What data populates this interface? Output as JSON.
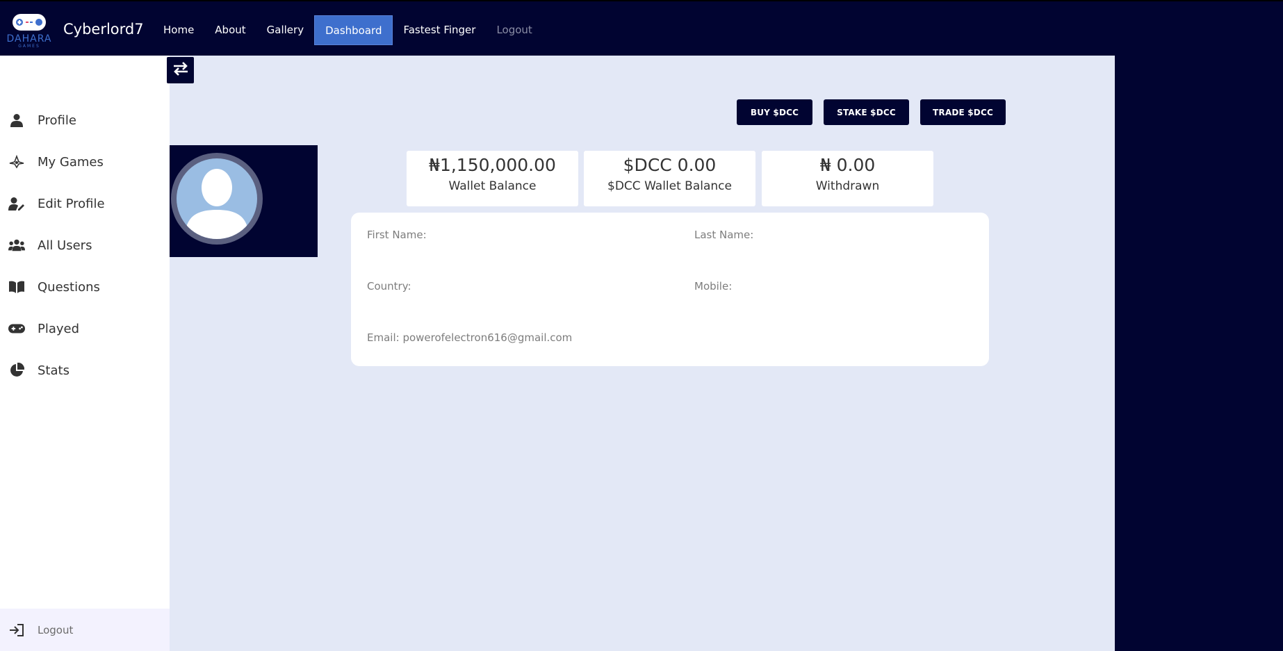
{
  "brand": {
    "name": "Cyberlord7",
    "logo_text": "DAHARA",
    "logo_sub": "GAMES"
  },
  "nav": {
    "home": "Home",
    "about": "About",
    "gallery": "Gallery",
    "dashboard": "Dashboard",
    "fastest_finger": "Fastest Finger",
    "logout": "Logout"
  },
  "sidebar": {
    "items": [
      {
        "label": "Profile",
        "icon": "user-icon"
      },
      {
        "label": "My Games",
        "icon": "games-icon"
      },
      {
        "label": "Edit Profile",
        "icon": "user-edit-icon"
      },
      {
        "label": "All Users",
        "icon": "users-icon"
      },
      {
        "label": "Questions",
        "icon": "book-icon"
      },
      {
        "label": "Played",
        "icon": "gamepad-icon"
      },
      {
        "label": "Stats",
        "icon": "pie-chart-icon"
      }
    ],
    "logout": "Logout"
  },
  "actions": {
    "buy": "BUY $DCC",
    "stake": "STAKE $DCC",
    "trade": "TRADE $DCC"
  },
  "stats": {
    "wallet": {
      "value": "₦1,150,000.00",
      "label": "Wallet Balance"
    },
    "dcc": {
      "value": "$DCC 0.00",
      "label": "$DCC Wallet Balance"
    },
    "withdrawn": {
      "value": "₦ 0.00",
      "label": "Withdrawn"
    }
  },
  "profile": {
    "first_name": "First Name:",
    "last_name": "Last Name:",
    "country": "Country:",
    "mobile": "Mobile:",
    "email": "Email: powerofelectron616@gmail.com"
  },
  "colors": {
    "navy": "#010431",
    "accent": "#3e6fcd",
    "page_bg": "#e3e8f6"
  }
}
